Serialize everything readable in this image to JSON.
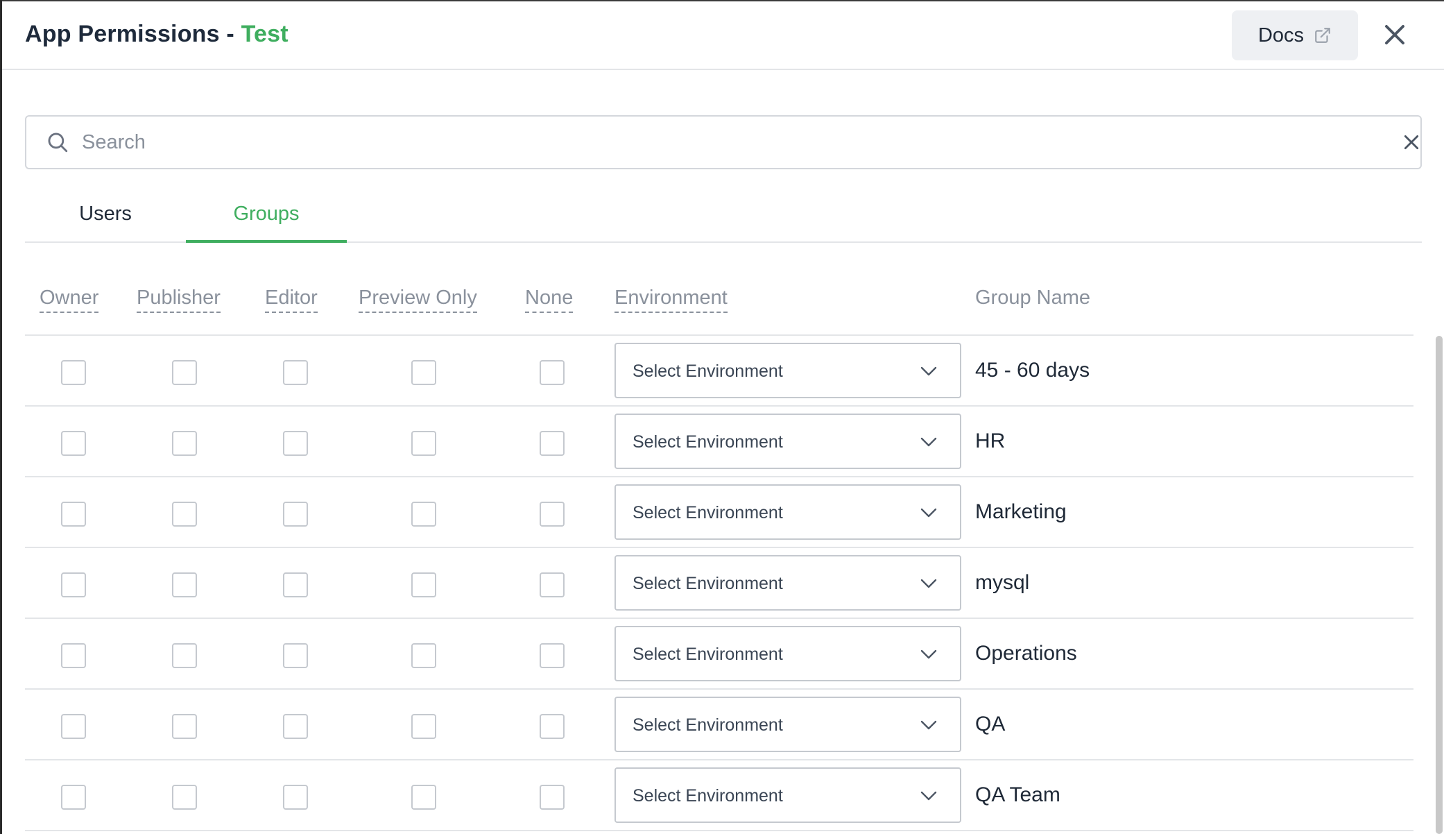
{
  "modal": {
    "title_prefix": "App Permissions - ",
    "app_name": "Test",
    "docs_label": "Docs",
    "close_icon": "close-icon"
  },
  "search": {
    "placeholder": "Search",
    "value": ""
  },
  "tabs": [
    {
      "label": "Users",
      "active": false
    },
    {
      "label": "Groups",
      "active": true
    }
  ],
  "columns": {
    "owner": "Owner",
    "publisher": "Publisher",
    "editor": "Editor",
    "preview_only": "Preview Only",
    "none": "None",
    "environment": "Environment",
    "group_name": "Group Name"
  },
  "rows": [
    {
      "group_name": "45 - 60 days",
      "environment": "Select Environment"
    },
    {
      "group_name": "HR",
      "environment": "Select Environment"
    },
    {
      "group_name": "Marketing",
      "environment": "Select Environment"
    },
    {
      "group_name": "mysql",
      "environment": "Select Environment"
    },
    {
      "group_name": "Operations",
      "environment": "Select Environment"
    },
    {
      "group_name": "QA",
      "environment": "Select Environment"
    },
    {
      "group_name": "QA Team",
      "environment": "Select Environment"
    }
  ],
  "colors": {
    "accent": "#3fae5f",
    "title": "#1e2a3b",
    "muted": "#8a919c",
    "border": "#c5c9cf"
  }
}
